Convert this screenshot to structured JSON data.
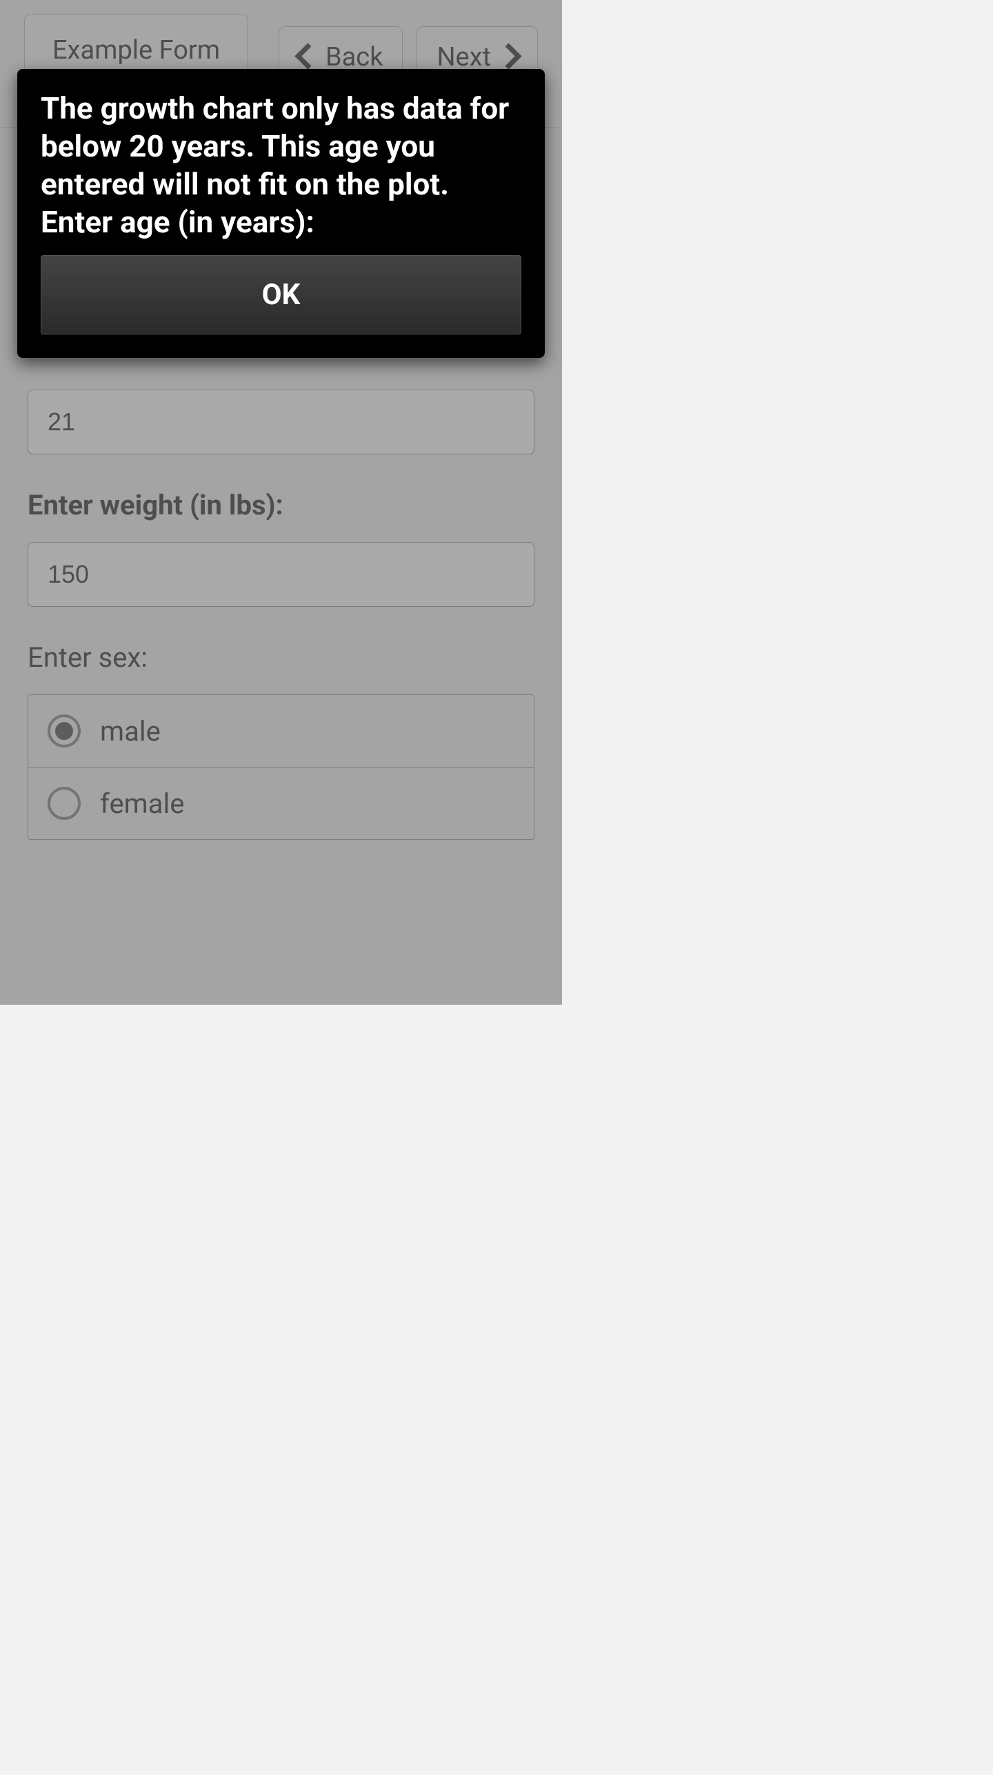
{
  "header": {
    "title": "Example Form",
    "back": "Back",
    "next": "Next"
  },
  "form": {
    "age_value": "21",
    "weight_label": "Enter weight (in lbs):",
    "weight_value": "150",
    "sex_label": "Enter sex:",
    "sex_options": {
      "male": "male",
      "female": "female"
    }
  },
  "dialog": {
    "message": "The growth chart only has data for below 20 years. This age you entered will not fit on the plot. Enter age (in years):",
    "ok": "OK"
  }
}
